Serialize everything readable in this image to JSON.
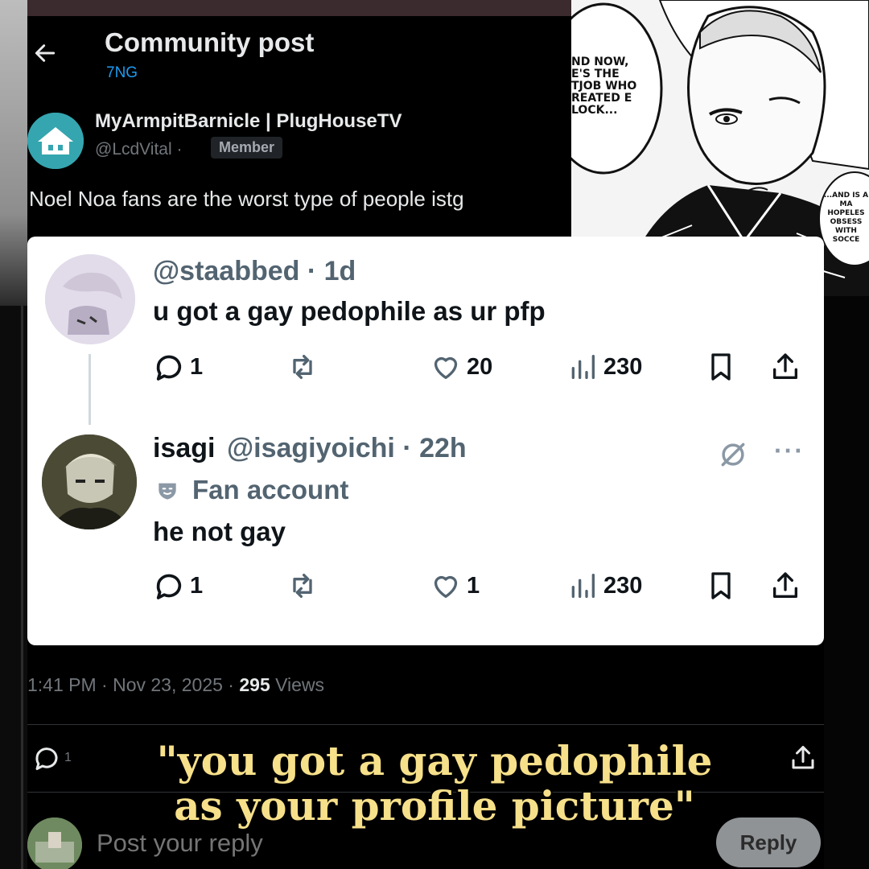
{
  "header": {
    "title": "Community post",
    "community": "7NG"
  },
  "post": {
    "author_name": "MyArmpitBarnicle | PlugHouseTV",
    "author_handle": "@LcdVital ·",
    "badge": "Member",
    "text": "Noel Noa fans are the worst type of people istg",
    "timestamp": "1:41 PM · Nov 23, 2025 ·",
    "views_count": "295",
    "views_label": "Views"
  },
  "replies": [
    {
      "handle": "@staabbed · 1d",
      "body": "u got a gay pedophile as ur pfp",
      "replies": "1",
      "likes": "20",
      "views": "230"
    },
    {
      "name": "isagi",
      "handle": "@isagiyoichi · 22h",
      "label": "Fan account",
      "body": "he not gay",
      "replies": "1",
      "likes": "1",
      "views": "230"
    }
  ],
  "bottom_bar": {
    "reply_count": "1"
  },
  "composer": {
    "placeholder": "Post your reply",
    "button": "Reply"
  },
  "manga_panel": {
    "bubble_left": "ND NOW, E'S THE TJOB WHO REATED E LOCK...",
    "bubble_right": "...AND IS A MA HOPELES OBSESS WITH SOCCE"
  },
  "caption": {
    "line1": "\"you got a gay pedophile",
    "line2": "as your profile picture\""
  },
  "colors": {
    "accent": "#1d9bf0",
    "caption": "#f7e08a",
    "background": "#000000"
  },
  "icons": [
    "back-arrow-icon",
    "reply-icon",
    "repost-icon",
    "like-icon",
    "views-icon",
    "bookmark-icon",
    "share-icon",
    "hide-icon",
    "fan-account-icon"
  ]
}
